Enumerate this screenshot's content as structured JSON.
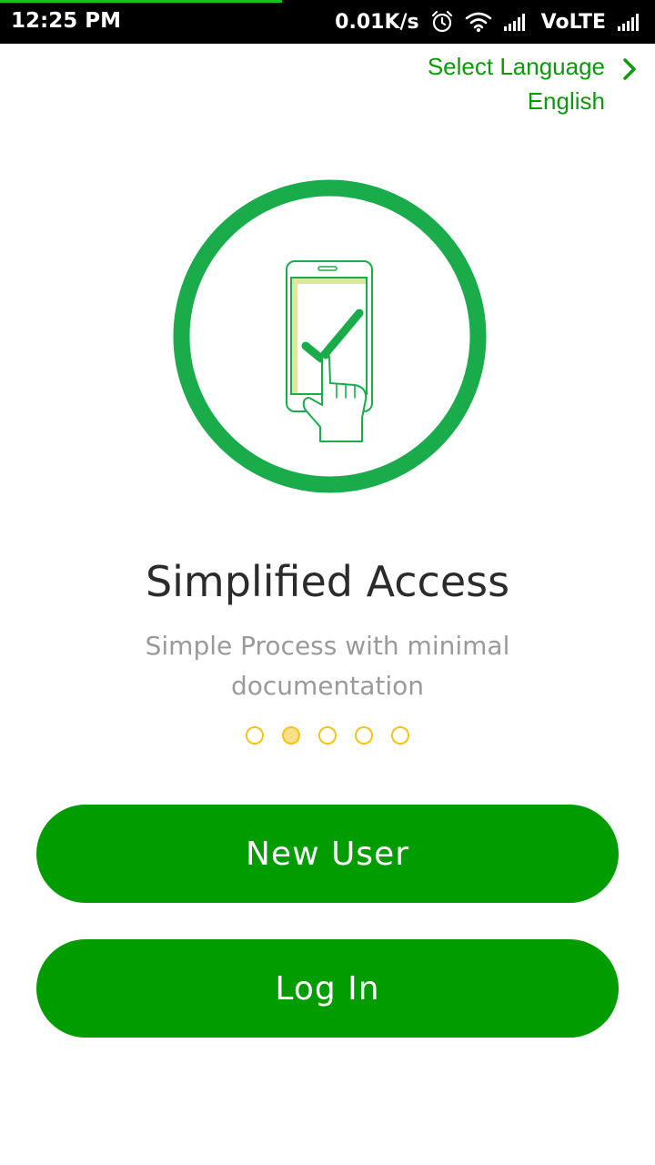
{
  "status_bar": {
    "time": "12:25 PM",
    "network_speed": "0.01K/s",
    "network_type": "VoLTE",
    "icons": [
      "alarm-icon",
      "wifi-icon",
      "signal-icon",
      "signal-icon"
    ],
    "load_progress": 0.43
  },
  "language": {
    "label": "Select Language",
    "value": "English",
    "icon": "chevron-right-icon"
  },
  "onboarding": {
    "illustration_icon": "phone-tap-check-icon",
    "title": "Simplified Access",
    "subtitle": "Simple Process with minimal documentation",
    "pages_total": 5,
    "current_page": 2
  },
  "actions": {
    "new_user_label": "New User",
    "login_label": "Log In"
  },
  "colors": {
    "primary": "#009c00",
    "ring": "#1aab4b",
    "dot_border": "#f0c419",
    "dot_active": "#fbe08a",
    "title": "#2b2b2b",
    "subtitle": "#9a9a9a"
  }
}
